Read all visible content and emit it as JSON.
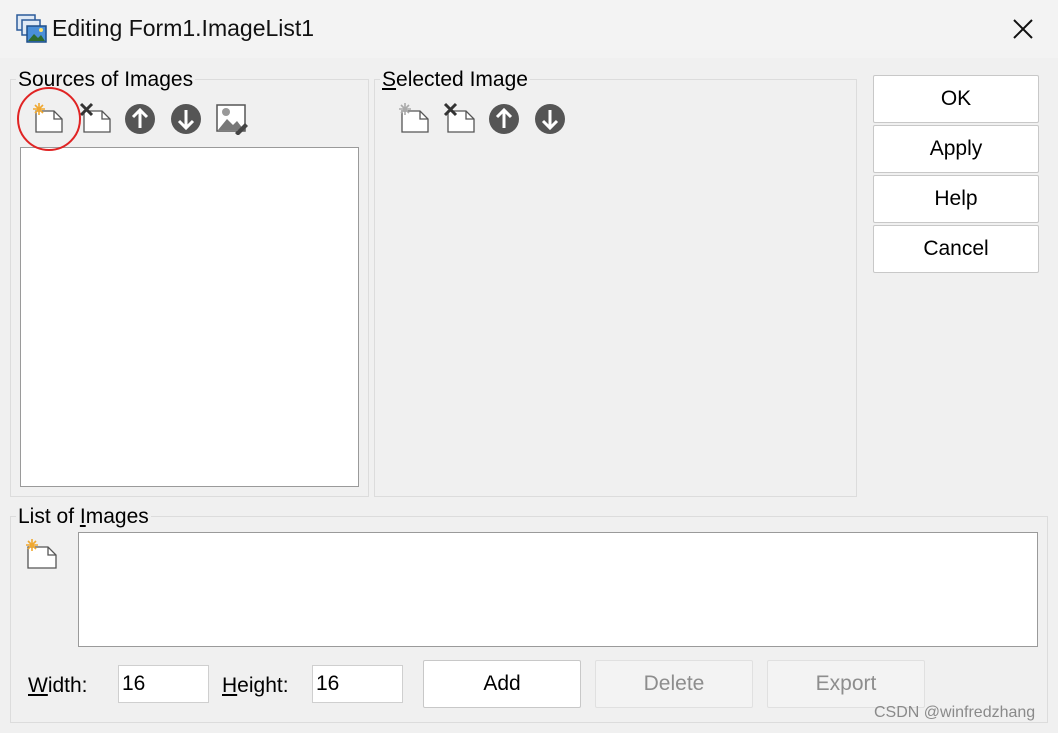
{
  "window": {
    "title": "Editing Form1.ImageList1"
  },
  "sources": {
    "label_prefix": "",
    "label_rest": "Sources of Images",
    "icons": [
      "new-doc-icon",
      "delete-doc-icon",
      "move-up-icon",
      "move-down-icon",
      "edit-image-icon"
    ]
  },
  "selected": {
    "label_u": "S",
    "label_rest": "elected Image",
    "icons": [
      "new-doc-icon",
      "delete-doc-icon",
      "move-up-icon",
      "move-down-icon"
    ]
  },
  "buttons": {
    "ok": "OK",
    "apply": "Apply",
    "help": "Help",
    "cancel": "Cancel"
  },
  "list": {
    "label_pre": "List of ",
    "label_u": "I",
    "label_rest": "mages"
  },
  "size": {
    "width_label_u": "W",
    "width_label_rest": "idth:",
    "width_value": "16",
    "height_label_u": "H",
    "height_label_rest": "eight:",
    "height_value": "16"
  },
  "actions": {
    "add": "Add",
    "delete": "Delete",
    "export": "Export"
  },
  "watermark": "CSDN @winfredzhang",
  "colors": {
    "highlight": "#e02424",
    "icon_circle": "#555555",
    "new_star": "#f0a830"
  }
}
